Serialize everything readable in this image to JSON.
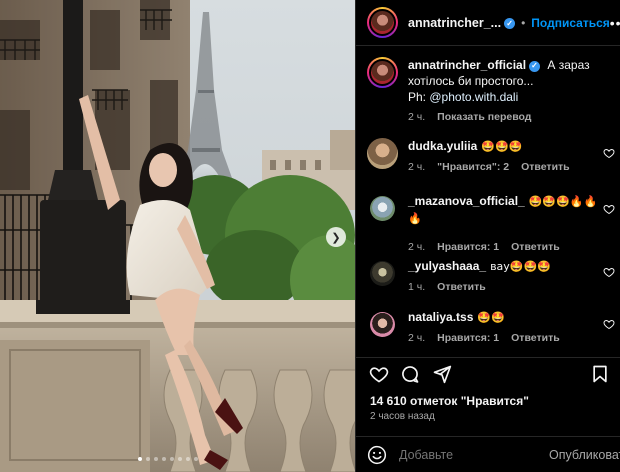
{
  "post": {
    "username": "annatrincher_...",
    "full_username": "annatrincher_official",
    "follow_label": "Подписаться",
    "caption_line1": "А зараз",
    "caption_line2": "хотілось би простого...",
    "caption_line3_prefix": "Ph:",
    "caption_mention": "@photo.with.dali",
    "caption_time": "2 ч.",
    "translate_label": "Показать перевод",
    "likes": "14 610 отметок \"Нравится\"",
    "posted": "2 часов назад"
  },
  "comments": [
    {
      "user": "dudka.yuliia",
      "text": "🤩🤩🤩",
      "time": "2 ч.",
      "likes": "\"Нравится\": 2",
      "reply": "Ответить"
    },
    {
      "user": "_mazanova_official_",
      "text": "🤩🤩🤩🔥🔥🔥",
      "time": "2 ч.",
      "likes": "Нравится: 1",
      "reply": "Ответить"
    },
    {
      "user": "_yulyashaaa_",
      "text": "вау🤩🤩🤩",
      "time": "1 ч.",
      "likes": "",
      "reply": "Ответить"
    },
    {
      "user": "nataliya.tss",
      "text": "🤩🤩",
      "time": "2 ч.",
      "likes": "Нравится: 1",
      "reply": "Ответить"
    }
  ],
  "composer": {
    "placeholder": "Добавьте",
    "post_label": "Опубликовать"
  },
  "carousel": {
    "count": 8,
    "active_index": 0
  },
  "colors": {
    "accent": "#0095f6",
    "verified": "#3897f0",
    "muted": "#a8a8a8",
    "panel_bg": "#000000"
  },
  "icons": [
    "verified-icon",
    "more-icon",
    "heart-icon",
    "comment-icon",
    "share-icon",
    "bookmark-icon",
    "emoji-icon",
    "chevron-right-icon"
  ]
}
